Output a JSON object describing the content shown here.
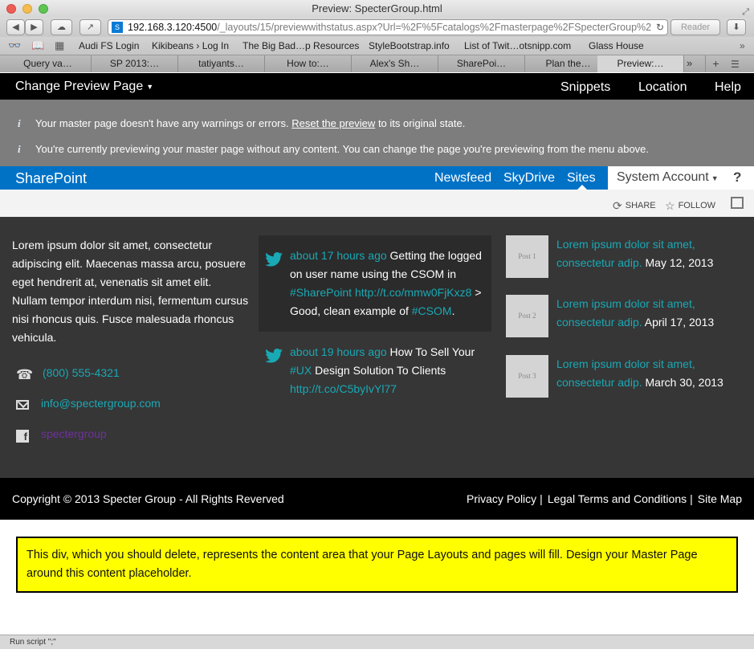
{
  "window": {
    "title": "Preview: SpecterGroup.html"
  },
  "browser": {
    "url_host": "192.168.3.120:4500",
    "url_path": "/_layouts/15/previewwithstatus.aspx?Url=%2F%5Fcatalogs%2Fmasterpage%2FSpecterGroup%2",
    "reader_label": "Reader",
    "bookmarks": [
      "Audi FS Login",
      "Kikibeans › Log In",
      "The Big Bad…p Resources",
      "StyleBootstrap.info",
      "List of Twit…otsnipp.com",
      "Glass House"
    ],
    "tabs": [
      "Query va…",
      "SP 2013:…",
      "tatiyants…",
      "How to:…",
      "Alex's Sh…",
      "SharePoi…",
      "Plan the…",
      "Preview:…"
    ],
    "active_tab": 7,
    "status_text": "Run script \";\""
  },
  "preview_bar": {
    "menu_label": "Change Preview Page",
    "links": [
      "Snippets",
      "Location",
      "Help"
    ]
  },
  "status_messages": {
    "line1_before": "Your master page doesn't have any warnings or errors.",
    "line1_link": "Reset the preview",
    "line1_after": "to its original state.",
    "line2": "You're currently previewing your master page without any content. You can change the page you're previewing from the menu above."
  },
  "suite_bar": {
    "brand": "SharePoint",
    "links": [
      "Newsfeed",
      "SkyDrive",
      "Sites"
    ],
    "account": "System Account",
    "help": "?",
    "brand_color": "#0072c6"
  },
  "actions": {
    "share": "SHARE",
    "follow": "FOLLOW"
  },
  "intro": {
    "text": "Lorem ipsum dolor sit amet, consectetur adipiscing elit. Maecenas massa arcu, posuere eget hendrerit at, venenatis sit amet elit. Nullam tempor interdum nisi, fermentum cursus nisi rhoncus quis. Fusce malesuada rhoncus vehicula."
  },
  "contacts": {
    "phone": "(800) 555-4321",
    "email": "info@spectergroup.com",
    "facebook": "spectergroup"
  },
  "tweets": [
    {
      "time": "about 17 hours ago",
      "t1": "Getting the logged on user name using the CSOM in",
      "link1": "#SharePoint http://t.co/mmw0FjKxz8",
      "t2": "> Good, clean example of",
      "link2": "#CSOM",
      "t3": "."
    },
    {
      "time": "about 19 hours ago",
      "t1": "How To Sell Your",
      "link1": "#UX",
      "t2": "Design Solution To Clients",
      "link2": "http://t.co/C5byIvYl77"
    }
  ],
  "posts": [
    {
      "thumb": "Post 1",
      "title": "Lorem ipsum dolor sit amet, consectetur adip.",
      "date": "May 12, 2013"
    },
    {
      "thumb": "Post 2",
      "title": "Lorem ipsum dolor sit amet, consectetur adip.",
      "date": "April 17, 2013"
    },
    {
      "thumb": "Post 3",
      "title": "Lorem ipsum dolor sit amet, consectetur adip.",
      "date": "March 30, 2013"
    }
  ],
  "footer": {
    "copyright": "Copyright © 2013 Specter Group - All Rights Reverved",
    "links": [
      "Privacy Policy",
      "Legal Terms and Conditions",
      "Site Map"
    ]
  },
  "placeholder": {
    "text": "This div, which you should delete, represents the content area that your Page Layouts and pages will fill. Design your Master Page around this content placeholder."
  },
  "colors": {
    "accent": "#19a9b5",
    "facebook_link": "#7030a0",
    "placeholder_bg": "#ffff00"
  }
}
